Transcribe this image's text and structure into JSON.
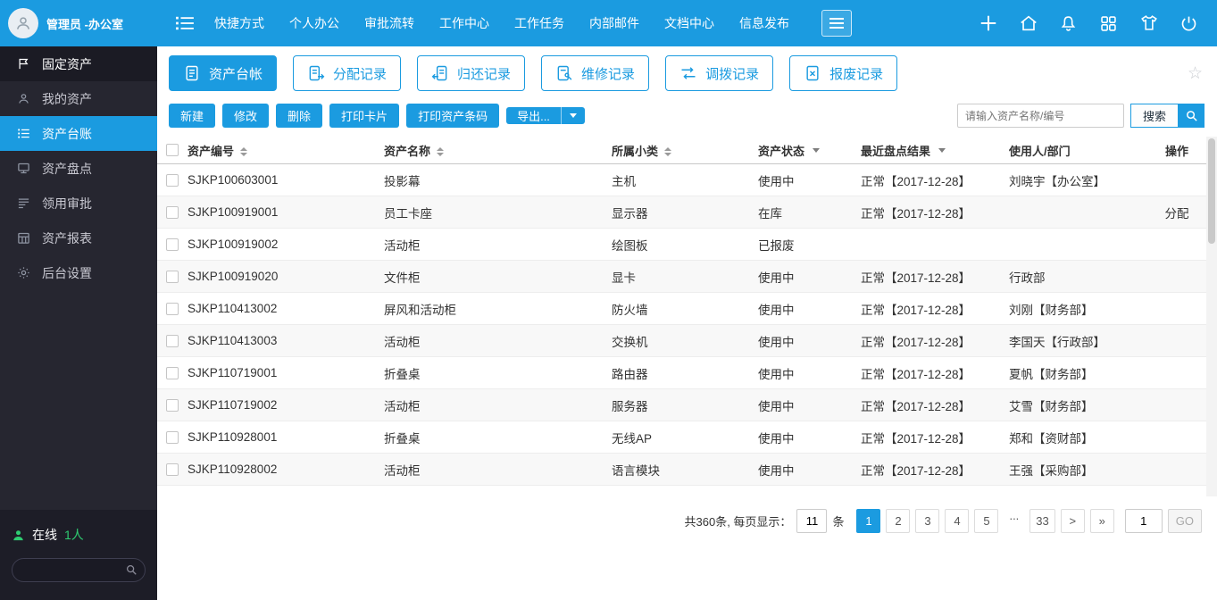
{
  "colors": {
    "accent": "#1b9be0",
    "sidebar_bg": "#262630",
    "online_green": "#2ecc71"
  },
  "topbar": {
    "user": "管理员 -办公室",
    "nav": [
      "快捷方式",
      "个人办公",
      "审批流转",
      "工作中心",
      "工作任务",
      "内部邮件",
      "文档中心",
      "信息发布"
    ]
  },
  "sidebar": {
    "items": [
      {
        "label": "固定资产"
      },
      {
        "label": "我的资产"
      },
      {
        "label": "资产台账"
      },
      {
        "label": "资产盘点"
      },
      {
        "label": "领用审批"
      },
      {
        "label": "资产报表"
      },
      {
        "label": "后台设置"
      }
    ],
    "online_label": "在线",
    "online_count": "1人"
  },
  "tabs": [
    {
      "label": "资产台帐"
    },
    {
      "label": "分配记录"
    },
    {
      "label": "归还记录"
    },
    {
      "label": "维修记录"
    },
    {
      "label": "调拨记录"
    },
    {
      "label": "报废记录"
    }
  ],
  "toolbar": {
    "buttons": [
      "新建",
      "修改",
      "删除",
      "打印卡片",
      "打印资产条码"
    ],
    "export_label": "导出...",
    "search_placeholder": "请输入资产名称/编号",
    "search_label": "搜索"
  },
  "table": {
    "headers": [
      "资产编号",
      "资产名称",
      "所属小类",
      "资产状态",
      "最近盘点结果",
      "使用人/部门",
      "操作"
    ],
    "rows": [
      [
        "SJKP100603001",
        "投影幕",
        "主机",
        "使用中",
        "正常【2017-12-28】",
        "刘晓宇【办公室】",
        ""
      ],
      [
        "SJKP100919001",
        "员工卡座",
        "显示器",
        "在库",
        "正常【2017-12-28】",
        "",
        "分配"
      ],
      [
        "SJKP100919002",
        "活动柜",
        "绘图板",
        "已报废",
        "",
        "",
        ""
      ],
      [
        "SJKP100919020",
        "文件柜",
        "显卡",
        "使用中",
        "正常【2017-12-28】",
        "行政部",
        ""
      ],
      [
        "SJKP110413002",
        "屏风和活动柜",
        "防火墙",
        "使用中",
        "正常【2017-12-28】",
        "刘刚【财务部】",
        ""
      ],
      [
        "SJKP110413003",
        "活动柜",
        "交换机",
        "使用中",
        "正常【2017-12-28】",
        "李国天【行政部】",
        ""
      ],
      [
        "SJKP110719001",
        "折叠桌",
        "路由器",
        "使用中",
        "正常【2017-12-28】",
        "夏帆【财务部】",
        ""
      ],
      [
        "SJKP110719002",
        "活动柜",
        "服务器",
        "使用中",
        "正常【2017-12-28】",
        "艾雪【财务部】",
        ""
      ],
      [
        "SJKP110928001",
        "折叠桌",
        "无线AP",
        "使用中",
        "正常【2017-12-28】",
        "郑和【资财部】",
        ""
      ],
      [
        "SJKP110928002",
        "活动柜",
        "语言模块",
        "使用中",
        "正常【2017-12-28】",
        "王强【采购部】",
        ""
      ]
    ]
  },
  "pagination": {
    "summary": "共360条, 每页显示：",
    "page_size": "11",
    "unit": "条",
    "pages": [
      "1",
      "2",
      "3",
      "4",
      "5",
      "...",
      "33"
    ],
    "next": ">",
    "last": "»",
    "goto_value": "1",
    "go_label": "GO"
  }
}
